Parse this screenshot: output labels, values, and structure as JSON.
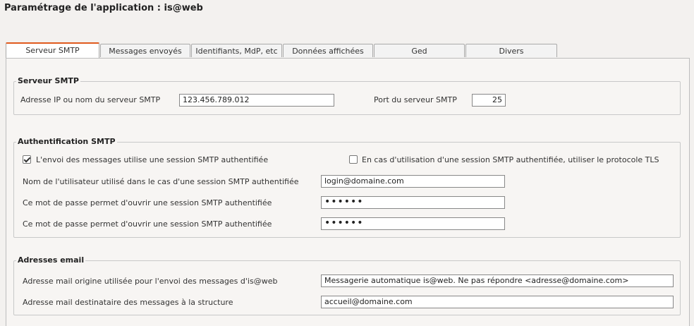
{
  "page_title": "Paramétrage de l'application : is@web",
  "tabs": [
    {
      "label": "Serveur SMTP",
      "active": true
    },
    {
      "label": "Messages envoyés"
    },
    {
      "label": "Identifiants, MdP, etc"
    },
    {
      "label": "Données affichées"
    },
    {
      "label": "Ged"
    },
    {
      "label": "Divers"
    }
  ],
  "smtp": {
    "legend": "Serveur SMTP",
    "address_label": "Adresse IP ou nom du serveur SMTP",
    "address_value": "123.456.789.012",
    "port_label": "Port du serveur SMTP",
    "port_value": "25"
  },
  "auth": {
    "legend": "Authentification SMTP",
    "session_checkbox_label": "L'envoi des messages utilise une session SMTP authentifiée",
    "session_checked": true,
    "tls_checkbox_label": "En cas d'utilisation d'une session SMTP authentifiée, utiliser le protocole TLS",
    "tls_checked": false,
    "username_label": "Nom de l'utilisateur utilisé dans le cas d'une session SMTP authentifiée",
    "username_value": "login@domaine.com",
    "password_label": "Ce mot de passe permet d'ouvrir une session SMTP authentifiée",
    "password_masked": "••••••",
    "password_confirm_label": "Ce mot de passe permet d'ouvrir une session SMTP authentifiée",
    "password_confirm_masked": "••••••"
  },
  "emails": {
    "legend": "Adresses email",
    "origin_label": "Adresse mail origine utilisée pour l'envoi des messages d'is@web",
    "origin_value": "Messagerie automatique is@web. Ne pas répondre <adresse@domaine.com>",
    "recipient_label": "Adresse mail destinataire des messages à la structure",
    "recipient_value": "accueil@domaine.com"
  }
}
